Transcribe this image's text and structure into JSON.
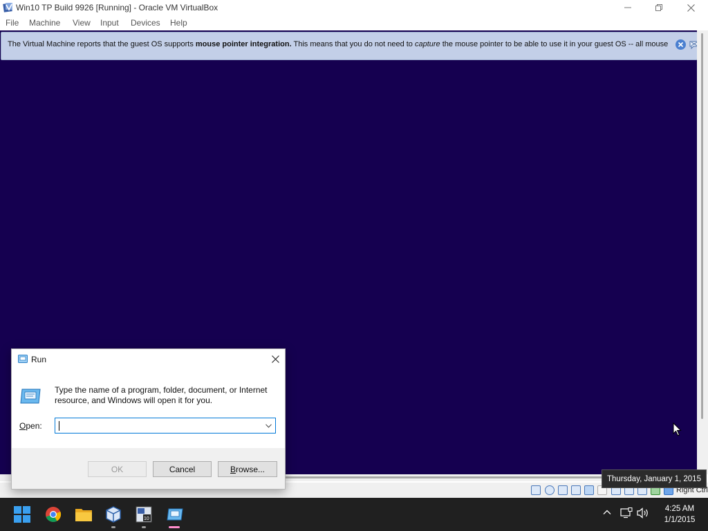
{
  "window": {
    "title": "Win10 TP Build 9926 [Running] - Oracle VM VirtualBox",
    "minimize": "minimize",
    "restore": "restore",
    "close": "close"
  },
  "menu": {
    "items": [
      "File",
      "Machine",
      "View",
      "Input",
      "Devices",
      "Help"
    ]
  },
  "banner": {
    "text_before": "The Virtual Machine reports that the guest OS supports ",
    "bold": "mouse pointer integration.",
    "text_middle": " This means that you do not need to ",
    "italic": "capture",
    "text_after": " the mouse pointer to be able to use it in your guest OS -- all mouse"
  },
  "statusbar": {
    "host_key": "Right Ctrl",
    "icons": [
      "hard-disk-icon",
      "optical-drive-icon",
      "audio-icon",
      "network-icon",
      "usb-icon",
      "shared-folders-icon",
      "display-icon",
      "video-capture-icon",
      "recording-icon",
      "cpu-icon",
      "mouse-integration-icon",
      "keyboard-icon"
    ]
  },
  "tooltip": {
    "text": "Thursday, January 1, 2015"
  },
  "run_dialog": {
    "title": "Run",
    "description": "Type the name of a program, folder, document, or Internet resource, and Windows will open it for you.",
    "open_label_accel": "O",
    "open_label_rest": "pen:",
    "open_value": "",
    "ok": "OK",
    "cancel": "Cancel",
    "browse_accel": "B",
    "browse_rest": "rowse..."
  },
  "taskbar": {
    "apps": [
      "start-icon",
      "chrome-icon",
      "file-explorer-icon",
      "virtualbox-icon",
      "windows10-app-icon",
      "run-app-icon"
    ],
    "time": "4:25 AM",
    "date": "1/1/2015"
  },
  "colors": {
    "guest_background": "#150050",
    "banner_background": "#c3cfe8",
    "taskbar": "#202020",
    "accent": "#0078d7"
  }
}
